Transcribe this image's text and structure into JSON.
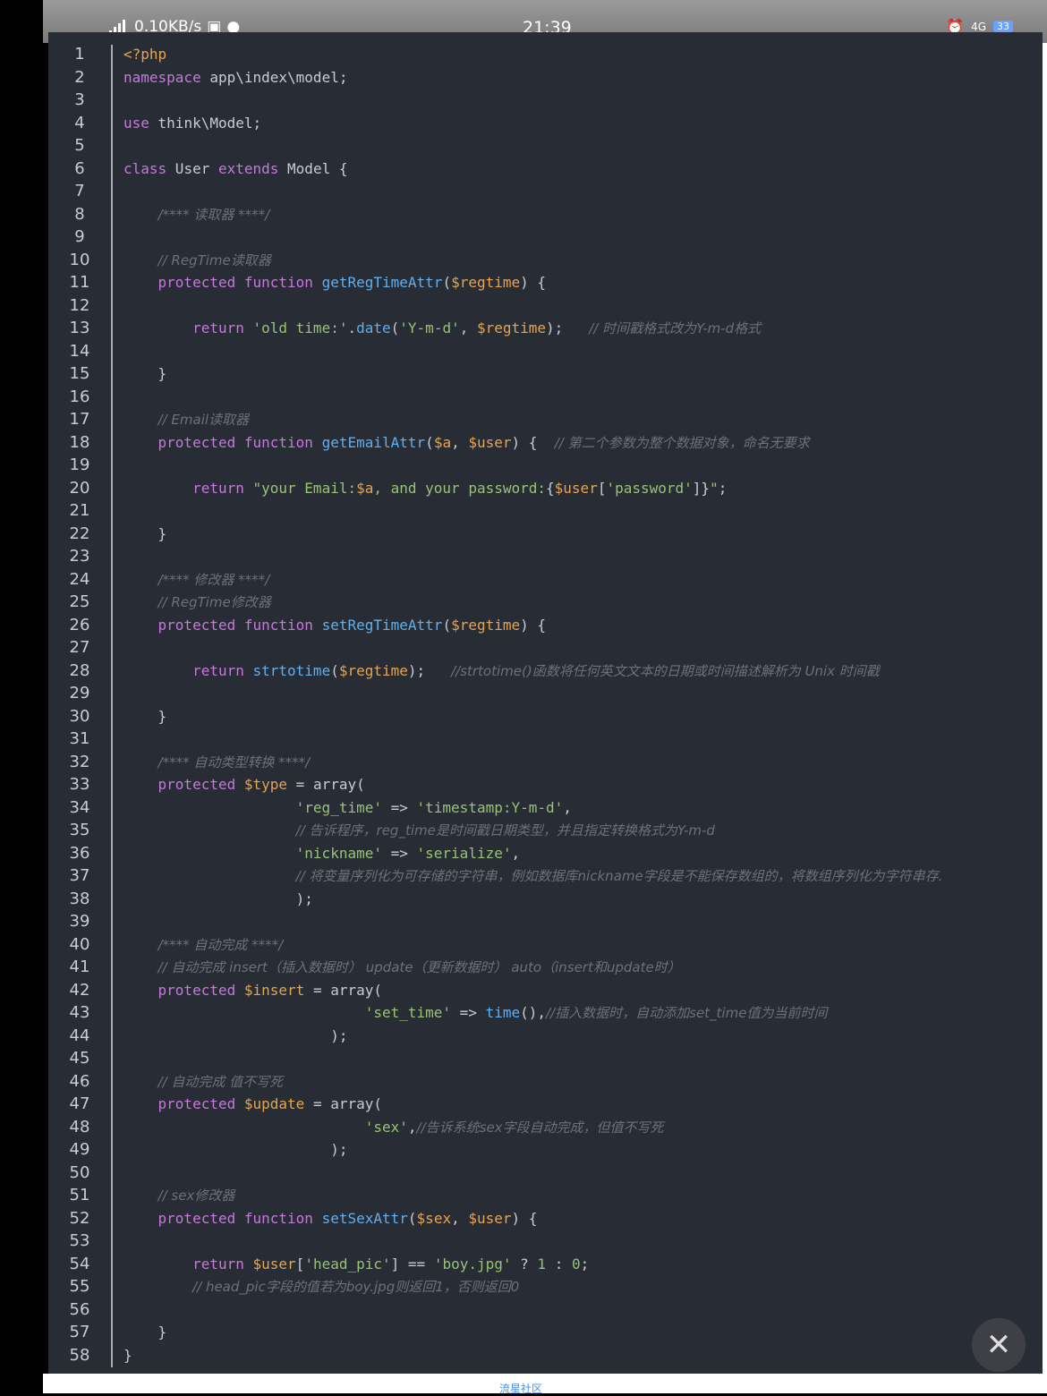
{
  "status_bar": {
    "network": "0.10KB/s",
    "time": "21:39",
    "battery": "33",
    "signal_label": "4G"
  },
  "footer": {
    "label": "流星社区"
  },
  "close_icon": "close-icon",
  "colors": {
    "editor_bg": "#282c34",
    "keyword": "#c678dd",
    "function": "#61afef",
    "string": "#98c379",
    "variable": "#e5a550",
    "comment": "#6b717d"
  },
  "code": {
    "line_numbers": [
      "1",
      "2",
      "3",
      "4",
      "5",
      "6",
      "7",
      "8",
      "9",
      "10",
      "11",
      "12",
      "13",
      "14",
      "15",
      "16",
      "17",
      "18",
      "19",
      "20",
      "21",
      "22",
      "23",
      "24",
      "25",
      "26",
      "27",
      "28",
      "29",
      "30",
      "31",
      "32",
      "33",
      "34",
      "35",
      "36",
      "37",
      "38",
      "39",
      "40",
      "41",
      "42",
      "43",
      "44",
      "45",
      "46",
      "47",
      "48",
      "49",
      "50",
      "51",
      "52",
      "53",
      "54",
      "55",
      "56",
      "57",
      "58"
    ],
    "lines": [
      [
        {
          "t": "tag",
          "v": "<?php"
        }
      ],
      [
        {
          "t": "kw",
          "v": "namespace"
        },
        {
          "t": "",
          "v": " app\\index\\model;"
        }
      ],
      [],
      [
        {
          "t": "kw",
          "v": "use"
        },
        {
          "t": "",
          "v": " think\\Model;"
        }
      ],
      [],
      [
        {
          "t": "kw",
          "v": "class"
        },
        {
          "t": "",
          "v": " User "
        },
        {
          "t": "kw",
          "v": "extends"
        },
        {
          "t": "",
          "v": " Model {"
        }
      ],
      [],
      [
        {
          "t": "",
          "v": "    "
        },
        {
          "t": "cm",
          "v": "/**** 读取器 ****/"
        }
      ],
      [],
      [
        {
          "t": "",
          "v": "    "
        },
        {
          "t": "cm",
          "v": "// RegTime读取器"
        }
      ],
      [
        {
          "t": "",
          "v": "    "
        },
        {
          "t": "kw",
          "v": "protected"
        },
        {
          "t": "",
          "v": " "
        },
        {
          "t": "kw",
          "v": "function"
        },
        {
          "t": "",
          "v": " "
        },
        {
          "t": "fn",
          "v": "getRegTimeAttr"
        },
        {
          "t": "",
          "v": "("
        },
        {
          "t": "var",
          "v": "$regtime"
        },
        {
          "t": "",
          "v": ") {"
        }
      ],
      [],
      [
        {
          "t": "",
          "v": "        "
        },
        {
          "t": "kw",
          "v": "return"
        },
        {
          "t": "",
          "v": " "
        },
        {
          "t": "str",
          "v": "'old time:'"
        },
        {
          "t": "",
          "v": "."
        },
        {
          "t": "fn",
          "v": "date"
        },
        {
          "t": "",
          "v": "("
        },
        {
          "t": "str",
          "v": "'Y-m-d'"
        },
        {
          "t": "",
          "v": ", "
        },
        {
          "t": "var",
          "v": "$regtime"
        },
        {
          "t": "",
          "v": ");   "
        },
        {
          "t": "cm",
          "v": "// 时间戳格式改为Y-m-d格式"
        }
      ],
      [],
      [
        {
          "t": "",
          "v": "    }"
        }
      ],
      [],
      [
        {
          "t": "",
          "v": "    "
        },
        {
          "t": "cm",
          "v": "// Email读取器"
        }
      ],
      [
        {
          "t": "",
          "v": "    "
        },
        {
          "t": "kw",
          "v": "protected"
        },
        {
          "t": "",
          "v": " "
        },
        {
          "t": "kw",
          "v": "function"
        },
        {
          "t": "",
          "v": " "
        },
        {
          "t": "fn",
          "v": "getEmailAttr"
        },
        {
          "t": "",
          "v": "("
        },
        {
          "t": "var",
          "v": "$a"
        },
        {
          "t": "",
          "v": ", "
        },
        {
          "t": "var",
          "v": "$user"
        },
        {
          "t": "",
          "v": ") {  "
        },
        {
          "t": "cm",
          "v": "// 第二个参数为整个数据对象，命名无要求"
        }
      ],
      [],
      [
        {
          "t": "",
          "v": "        "
        },
        {
          "t": "kw",
          "v": "return"
        },
        {
          "t": "",
          "v": " "
        },
        {
          "t": "str",
          "v": "\"your Email:"
        },
        {
          "t": "var",
          "v": "$a"
        },
        {
          "t": "str",
          "v": ", and your password:"
        },
        {
          "t": "",
          "v": "{"
        },
        {
          "t": "var",
          "v": "$user"
        },
        {
          "t": "",
          "v": "["
        },
        {
          "t": "str",
          "v": "'password'"
        },
        {
          "t": "",
          "v": "]}"
        },
        {
          "t": "str",
          "v": "\""
        },
        {
          "t": "",
          "v": ";"
        }
      ],
      [],
      [
        {
          "t": "",
          "v": "    }"
        }
      ],
      [],
      [
        {
          "t": "",
          "v": "    "
        },
        {
          "t": "cm",
          "v": "/**** 修改器 ****/"
        }
      ],
      [
        {
          "t": "",
          "v": "    "
        },
        {
          "t": "cm",
          "v": "// RegTime修改器"
        }
      ],
      [
        {
          "t": "",
          "v": "    "
        },
        {
          "t": "kw",
          "v": "protected"
        },
        {
          "t": "",
          "v": " "
        },
        {
          "t": "kw",
          "v": "function"
        },
        {
          "t": "",
          "v": " "
        },
        {
          "t": "fn",
          "v": "setRegTimeAttr"
        },
        {
          "t": "",
          "v": "("
        },
        {
          "t": "var",
          "v": "$regtime"
        },
        {
          "t": "",
          "v": ") {"
        }
      ],
      [],
      [
        {
          "t": "",
          "v": "        "
        },
        {
          "t": "kw",
          "v": "return"
        },
        {
          "t": "",
          "v": " "
        },
        {
          "t": "fn",
          "v": "strtotime"
        },
        {
          "t": "",
          "v": "("
        },
        {
          "t": "var",
          "v": "$regtime"
        },
        {
          "t": "",
          "v": ");   "
        },
        {
          "t": "cm",
          "v": "//strtotime()函数将任何英文文本的日期或时间描述解析为 Unix 时间戳"
        }
      ],
      [],
      [
        {
          "t": "",
          "v": "    }"
        }
      ],
      [],
      [
        {
          "t": "",
          "v": "    "
        },
        {
          "t": "cm",
          "v": "/**** 自动类型转换 ****/"
        }
      ],
      [
        {
          "t": "",
          "v": "    "
        },
        {
          "t": "kw",
          "v": "protected"
        },
        {
          "t": "",
          "v": " "
        },
        {
          "t": "var",
          "v": "$type"
        },
        {
          "t": "",
          "v": " = array("
        }
      ],
      [
        {
          "t": "",
          "v": "                    "
        },
        {
          "t": "str",
          "v": "'reg_time'"
        },
        {
          "t": "",
          "v": " => "
        },
        {
          "t": "str",
          "v": "'timestamp:Y-m-d'"
        },
        {
          "t": "",
          "v": ","
        }
      ],
      [
        {
          "t": "",
          "v": "                    "
        },
        {
          "t": "cm",
          "v": "// 告诉程序，reg_time是时间戳日期类型，并且指定转换格式为Y-m-d"
        }
      ],
      [
        {
          "t": "",
          "v": "                    "
        },
        {
          "t": "str",
          "v": "'nickname'"
        },
        {
          "t": "",
          "v": " => "
        },
        {
          "t": "str",
          "v": "'serialize'"
        },
        {
          "t": "",
          "v": ","
        }
      ],
      [
        {
          "t": "",
          "v": "                    "
        },
        {
          "t": "cm",
          "v": "// 将变量序列化为可存储的字符串，例如数据库nickname字段是不能保存数组的，将数组序列化为字符串存."
        }
      ],
      [
        {
          "t": "",
          "v": "                    );"
        }
      ],
      [],
      [
        {
          "t": "",
          "v": "    "
        },
        {
          "t": "cm",
          "v": "/**** 自动完成 ****/"
        }
      ],
      [
        {
          "t": "",
          "v": "    "
        },
        {
          "t": "cm",
          "v": "// 自动完成 insert（插入数据时） update（更新数据时） auto（insert和update时）"
        }
      ],
      [
        {
          "t": "",
          "v": "    "
        },
        {
          "t": "kw",
          "v": "protected"
        },
        {
          "t": "",
          "v": " "
        },
        {
          "t": "var",
          "v": "$insert"
        },
        {
          "t": "",
          "v": " = array("
        }
      ],
      [
        {
          "t": "",
          "v": "                            "
        },
        {
          "t": "str",
          "v": "'set_time'"
        },
        {
          "t": "",
          "v": " => "
        },
        {
          "t": "fn",
          "v": "time"
        },
        {
          "t": "",
          "v": "(),"
        },
        {
          "t": "cm",
          "v": "//插入数据时，自动添加set_time值为当前时间"
        }
      ],
      [
        {
          "t": "",
          "v": "                        );"
        }
      ],
      [],
      [
        {
          "t": "",
          "v": "    "
        },
        {
          "t": "cm",
          "v": "// 自动完成 值不写死"
        }
      ],
      [
        {
          "t": "",
          "v": "    "
        },
        {
          "t": "kw",
          "v": "protected"
        },
        {
          "t": "",
          "v": " "
        },
        {
          "t": "var",
          "v": "$update"
        },
        {
          "t": "",
          "v": " = array("
        }
      ],
      [
        {
          "t": "",
          "v": "                            "
        },
        {
          "t": "str",
          "v": "'sex'"
        },
        {
          "t": "",
          "v": ","
        },
        {
          "t": "cm",
          "v": "//告诉系统sex字段自动完成，但值不写死"
        }
      ],
      [
        {
          "t": "",
          "v": "                        );"
        }
      ],
      [],
      [
        {
          "t": "",
          "v": "    "
        },
        {
          "t": "cm",
          "v": "// sex修改器"
        }
      ],
      [
        {
          "t": "",
          "v": "    "
        },
        {
          "t": "kw",
          "v": "protected"
        },
        {
          "t": "",
          "v": " "
        },
        {
          "t": "kw",
          "v": "function"
        },
        {
          "t": "",
          "v": " "
        },
        {
          "t": "fn",
          "v": "setSexAttr"
        },
        {
          "t": "",
          "v": "("
        },
        {
          "t": "var",
          "v": "$sex"
        },
        {
          "t": "",
          "v": ", "
        },
        {
          "t": "var",
          "v": "$user"
        },
        {
          "t": "",
          "v": ") {"
        }
      ],
      [],
      [
        {
          "t": "",
          "v": "        "
        },
        {
          "t": "kw",
          "v": "return"
        },
        {
          "t": "",
          "v": " "
        },
        {
          "t": "var",
          "v": "$user"
        },
        {
          "t": "",
          "v": "["
        },
        {
          "t": "str",
          "v": "'head_pic'"
        },
        {
          "t": "",
          "v": "] == "
        },
        {
          "t": "str",
          "v": "'boy.jpg'"
        },
        {
          "t": "",
          "v": " ? "
        },
        {
          "t": "str",
          "v": "1"
        },
        {
          "t": "",
          "v": " : "
        },
        {
          "t": "str",
          "v": "0"
        },
        {
          "t": "",
          "v": ";"
        }
      ],
      [
        {
          "t": "",
          "v": "        "
        },
        {
          "t": "cm",
          "v": "// head_pic字段的值若为boy.jpg则返回1，否则返回0"
        }
      ],
      [],
      [
        {
          "t": "",
          "v": "    }"
        }
      ],
      [
        {
          "t": "",
          "v": "}"
        }
      ]
    ]
  }
}
